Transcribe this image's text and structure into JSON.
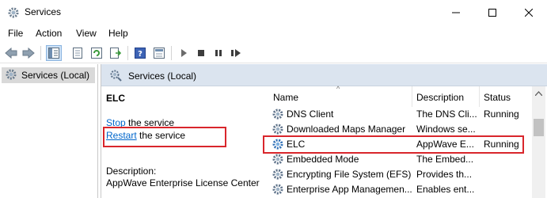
{
  "window": {
    "title": "Services",
    "controls": [
      "minimize",
      "maximize",
      "close"
    ]
  },
  "menu": {
    "items": [
      "File",
      "Action",
      "View",
      "Help"
    ]
  },
  "toolbar": {
    "icons": [
      "back-arrow-icon",
      "forward-arrow-icon",
      "show-tree-icon",
      "properties-icon",
      "refresh-icon",
      "export-icon",
      "help-icon",
      "console-icon",
      "start-icon",
      "stop-icon",
      "pause-icon",
      "restart-icon"
    ]
  },
  "tree": {
    "node": "Services (Local)"
  },
  "pane": {
    "header": "Services (Local)",
    "selected_title": "ELC",
    "stop_link": "Stop",
    "stop_rest": " the service",
    "restart_link": "Restart",
    "restart_rest": " the service",
    "description_label": "Description:",
    "description_value": "AppWave Enterprise License Center"
  },
  "list": {
    "columns": [
      "Name",
      "Description",
      "Status"
    ],
    "rows": [
      {
        "name": "DNS Client",
        "description": "The DNS Cli...",
        "status": "Running"
      },
      {
        "name": "Downloaded Maps Manager",
        "description": "Windows se...",
        "status": ""
      },
      {
        "name": "ELC",
        "description": "AppWave E...",
        "status": "Running"
      },
      {
        "name": "Embedded Mode",
        "description": "The Embed...",
        "status": ""
      },
      {
        "name": "Encrypting File System (EFS)",
        "description": "Provides th...",
        "status": ""
      },
      {
        "name": "Enterprise App Managemen...",
        "description": "Enables ent...",
        "status": ""
      }
    ]
  },
  "colors": {
    "highlight_box": "#d9262c",
    "link": "#0066cc",
    "pane_header": "#dbe4ef",
    "tree_selected": "#d9d9d9"
  }
}
